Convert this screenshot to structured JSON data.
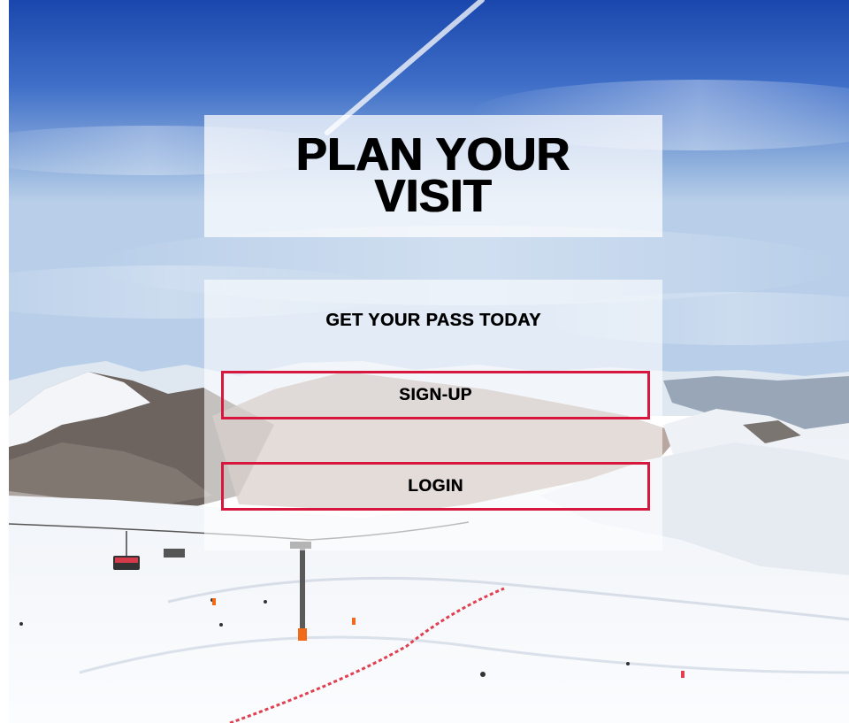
{
  "hero": {
    "title": "PLAN YOUR VISIT",
    "background": "ski-resort-mountain-photo"
  },
  "cta": {
    "heading": "GET YOUR PASS TODAY",
    "signup_label": "SIGN-UP",
    "login_label": "LOGIN"
  },
  "colors": {
    "button_border": "#d8173f",
    "text": "#000000",
    "sky_top": "#1c4fb5",
    "snow": "#f2f5f9"
  }
}
